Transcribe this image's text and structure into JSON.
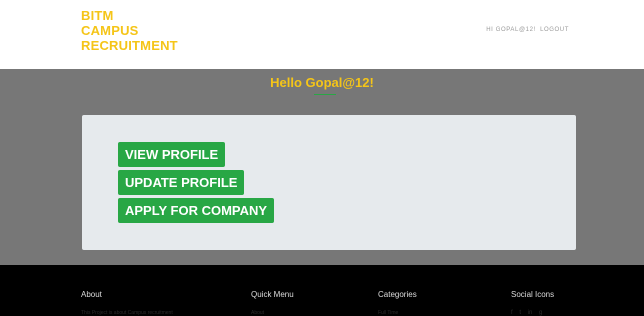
{
  "brand": {
    "lines": [
      "BITM",
      "CAMPUS",
      "RECRUITMENT"
    ]
  },
  "topnav": {
    "greeting": "HI GOPAL@12!",
    "logout": "LOGOUT"
  },
  "hero": {
    "greeting": "Hello Gopal@12!",
    "buttons": [
      "VIEW PROFILE",
      "UPDATE PROFILE",
      "APPLY FOR COMPANY"
    ]
  },
  "footer": {
    "about": {
      "heading": "About",
      "text": "This Project is about Campus recruitment"
    },
    "quick_menu": {
      "heading": "Quick Menu",
      "first_item": "About"
    },
    "categories": {
      "heading": "Categories",
      "first_item": "Full Time"
    },
    "social": {
      "heading": "Social Icons",
      "icons": [
        "f",
        "t",
        "in",
        "g"
      ]
    }
  },
  "colors": {
    "accent": "#f5c518",
    "button": "#28a745",
    "hero_bg": "#777777",
    "card_bg": "#e6eaed"
  }
}
